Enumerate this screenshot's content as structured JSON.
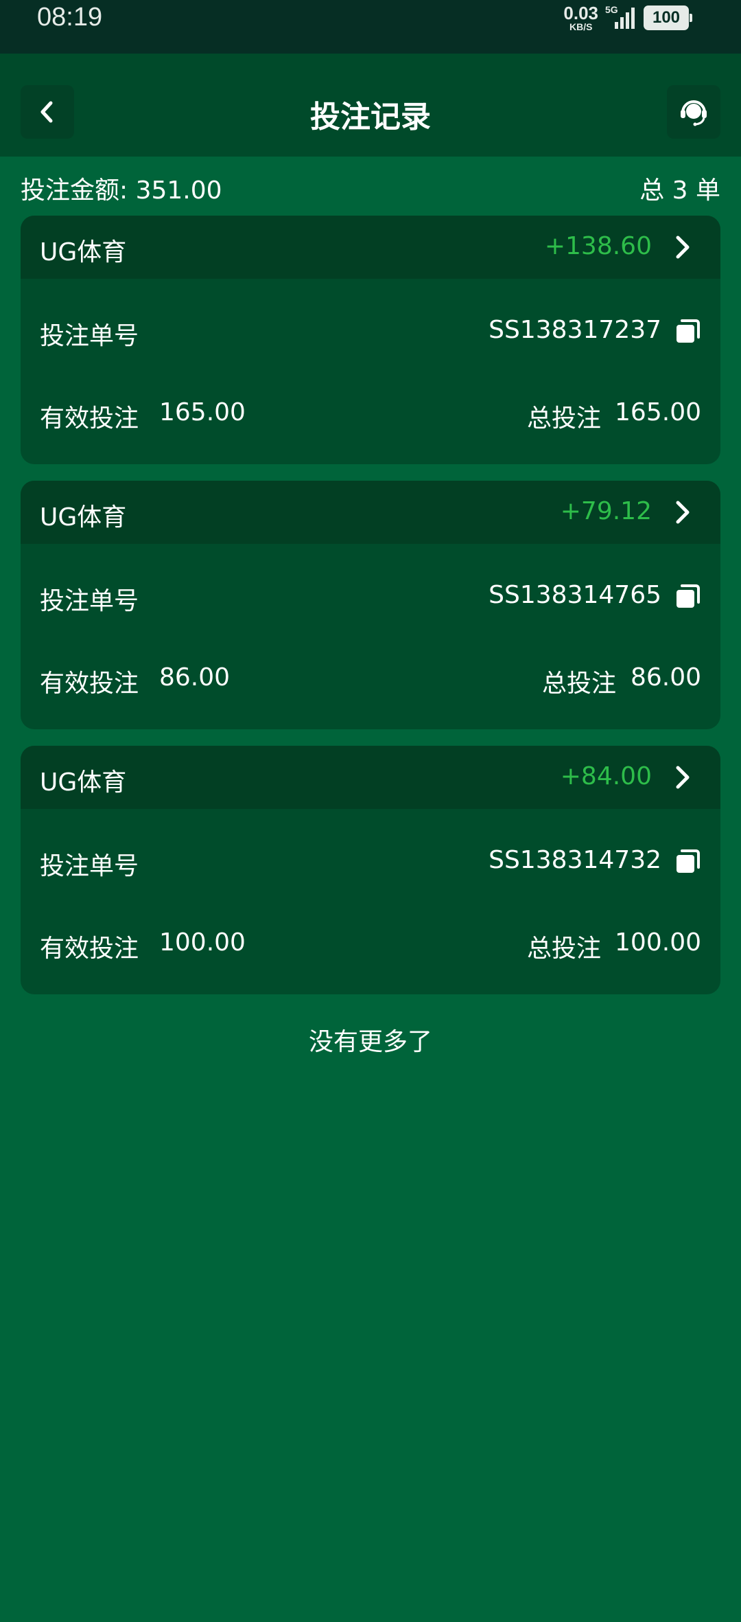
{
  "status": {
    "time": "08:19",
    "net_speed_value": "0.03",
    "net_speed_unit": "KB/S",
    "network": "5G",
    "battery": "100"
  },
  "header": {
    "title": "投注记录",
    "back_icon": "chevron-left-icon",
    "service_icon": "customer-service-headset-icon"
  },
  "summary": {
    "amount_text": "投注金额: 351.00",
    "count_text": "总 3 单"
  },
  "labels": {
    "order_no": "投注单号",
    "valid_bet": "有效投注",
    "total_bet": "总投注"
  },
  "records": [
    {
      "provider": "UG体育",
      "profit": "+138.60",
      "order_no": "SS138317237",
      "valid_bet": "165.00",
      "total_bet": "165.00"
    },
    {
      "provider": "UG体育",
      "profit": "+79.12",
      "order_no": "SS138314765",
      "valid_bet": "86.00",
      "total_bet": "86.00"
    },
    {
      "provider": "UG体育",
      "profit": "+84.00",
      "order_no": "SS138314732",
      "valid_bet": "100.00",
      "total_bet": "100.00"
    }
  ],
  "footer": {
    "no_more": "没有更多了"
  },
  "colors": {
    "background": "#00643a",
    "header": "#004a2a",
    "card": "#004c2b",
    "card_header": "#023f23",
    "profit": "#2ebd4a",
    "status_bar": "#062e24"
  }
}
